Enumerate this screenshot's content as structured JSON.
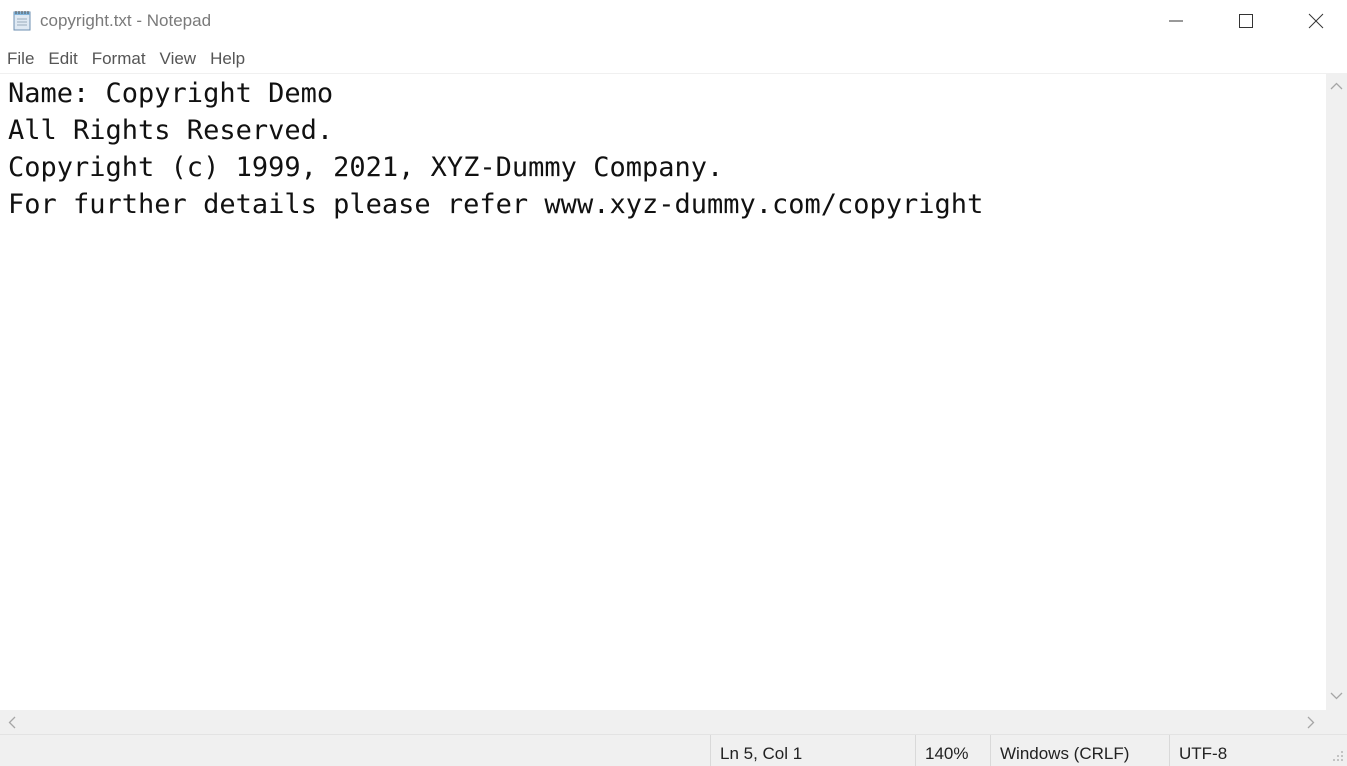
{
  "window": {
    "title": "copyright.txt - Notepad",
    "icons": {
      "app": "notepad-icon",
      "minimize": "minimize-icon",
      "maximize": "maximize-icon",
      "close": "close-icon"
    }
  },
  "menu": {
    "items": [
      {
        "label": "File"
      },
      {
        "label": "Edit"
      },
      {
        "label": "Format"
      },
      {
        "label": "View"
      },
      {
        "label": "Help"
      }
    ]
  },
  "editor": {
    "lines": [
      "Name: Copyright Demo",
      "All Rights Reserved.",
      "Copyright (c) 1999, 2021, XYZ-Dummy Company.",
      "For further details please refer www.xyz-dummy.com/copyright"
    ]
  },
  "status": {
    "position": "Ln 5, Col 1",
    "zoom": "140%",
    "line_ending": "Windows (CRLF)",
    "encoding": "UTF-8"
  },
  "colors": {
    "title_text": "#7a7a7a",
    "chrome_background": "#f0f0f0",
    "text": "#111111"
  }
}
